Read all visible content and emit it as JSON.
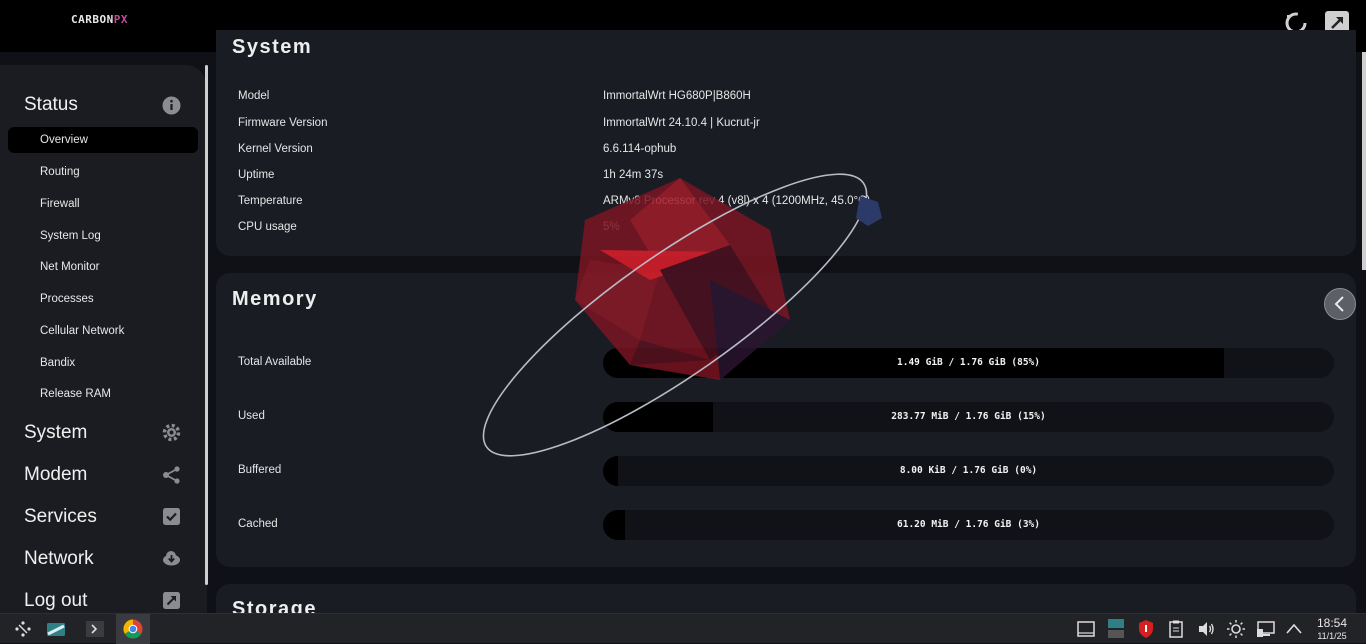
{
  "app": {
    "logo_text": "CARBON",
    "logo_suffix": "PX"
  },
  "sidebar": {
    "sections": [
      {
        "label": "Status",
        "icon": "info-icon"
      },
      {
        "label": "System",
        "icon": "gear-icon"
      },
      {
        "label": "Modem",
        "icon": "share-icon"
      },
      {
        "label": "Services",
        "icon": "checkbox-icon"
      },
      {
        "label": "Network",
        "icon": "cloud-download-icon"
      },
      {
        "label": "Log out",
        "icon": "external-link-icon"
      }
    ],
    "status_items": [
      {
        "label": "Overview",
        "active": true
      },
      {
        "label": "Routing"
      },
      {
        "label": "Firewall"
      },
      {
        "label": "System Log"
      },
      {
        "label": "Net Monitor"
      },
      {
        "label": "Processes"
      },
      {
        "label": "Cellular Network"
      },
      {
        "label": "Bandix"
      },
      {
        "label": "Release RAM"
      }
    ]
  },
  "system_card": {
    "title": "System",
    "rows": [
      {
        "label": "Model",
        "value": "ImmortalWrt HG680P|B860H"
      },
      {
        "label": "Firmware Version",
        "value": "ImmortalWrt 24.10.4 | Kucrut-jr"
      },
      {
        "label": "Kernel Version",
        "value": "6.6.114-ophub"
      },
      {
        "label": "Uptime",
        "value": "1h 24m 37s"
      },
      {
        "label": "Temperature",
        "value": "ARMv8 Processor rev 4 (v8l) x 4 (1200MHz, 45.0°C)"
      },
      {
        "label": "CPU usage",
        "value": "5%"
      }
    ]
  },
  "memory_card": {
    "title": "Memory",
    "rows": [
      {
        "label": "Total Available",
        "text": "1.49 GiB / 1.76 GiB (85%)",
        "fraction": 0.85
      },
      {
        "label": "Used",
        "text": "283.77 MiB / 1.76 GiB (15%)",
        "fraction": 0.15
      },
      {
        "label": "Buffered",
        "text": "8.00 KiB / 1.76 GiB (0%)",
        "fraction": 0.02
      },
      {
        "label": "Cached",
        "text": "61.20 MiB / 1.76 GiB (3%)",
        "fraction": 0.03
      }
    ]
  },
  "storage_card": {
    "title": "Storage"
  },
  "taskbar": {
    "time": "18:54",
    "date": "11/1/25"
  },
  "colors": {
    "background": "#0f1116",
    "card": "#1a1c24",
    "topbar": "#000000",
    "accent_logo": "#c44a9a"
  }
}
